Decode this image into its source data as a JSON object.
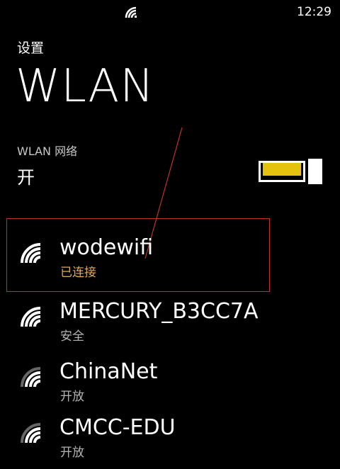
{
  "status_bar": {
    "time": "12:29",
    "wifi_icon": "wifi-signal-icon"
  },
  "header": {
    "app_title": "设置",
    "page_title": "WLAN"
  },
  "wlan_setting": {
    "label": "WLAN 网络",
    "state": "开",
    "toggle_on": true,
    "accent_color": "#e4c20e"
  },
  "networks": [
    {
      "name": "wodewifi",
      "status": "已连接",
      "connected": true,
      "icon": "wifi-strong-icon"
    },
    {
      "name": "MERCURY_B3CC7A",
      "status": "安全",
      "connected": false,
      "icon": "wifi-strong-icon"
    },
    {
      "name": "ChinaNet",
      "status": "开放",
      "connected": false,
      "icon": "wifi-medium-icon"
    },
    {
      "name": "CMCC-EDU",
      "status": "开放",
      "connected": false,
      "icon": "wifi-medium-icon"
    }
  ],
  "colors": {
    "background": "#000000",
    "text": "#ffffff",
    "connected_status": "#e0a85a",
    "annotation": "#c0312a"
  }
}
